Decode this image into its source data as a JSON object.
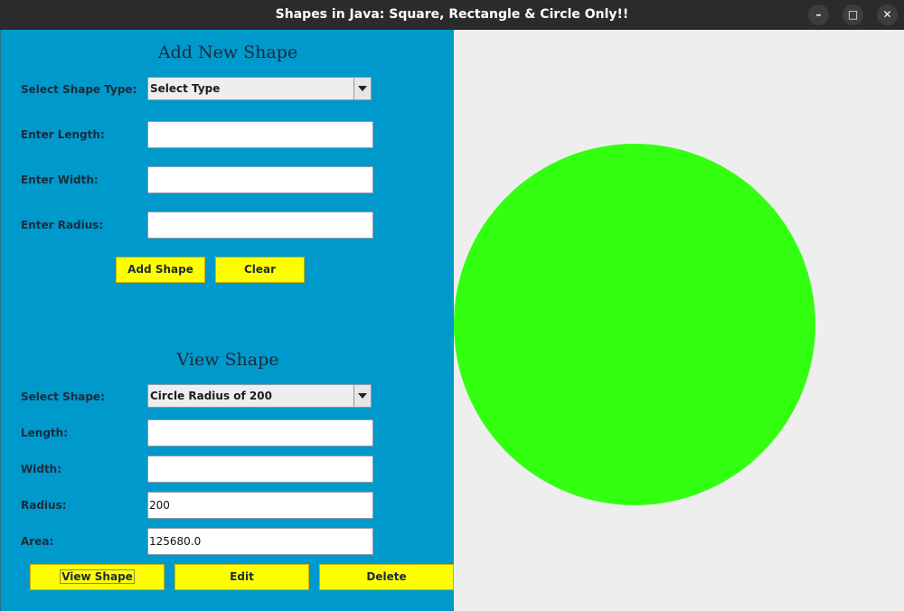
{
  "window": {
    "title": "Shapes in Java: Square, Rectangle & Circle Only!!",
    "controls": {
      "minimize": "–",
      "maximize": "□",
      "close": "✕"
    }
  },
  "add_panel": {
    "heading": "Add New Shape",
    "shape_type_label": "Select Shape Type:",
    "shape_type_selected": "Select Type",
    "length_label": "Enter Length:",
    "length_value": "",
    "width_label": "Enter Width:",
    "width_value": "",
    "radius_label": "Enter Radius:",
    "radius_value": "",
    "add_button": "Add Shape",
    "clear_button": "Clear"
  },
  "view_panel": {
    "heading": "View Shape",
    "shape_label": "Select Shape:",
    "shape_selected": "Circle Radius of 200",
    "length_label": "Length:",
    "length_value": "",
    "width_label": "Width:",
    "width_value": "",
    "radius_label": "Radius:",
    "radius_value": "200",
    "area_label": "Area:",
    "area_value": "125680.0",
    "view_button": "View Shape",
    "edit_button": "Edit",
    "delete_button": "Delete"
  },
  "canvas": {
    "shape": "circle",
    "fill_color": "#33ff11",
    "background": "#eeeeee"
  },
  "colors": {
    "panel_bg": "#0099cc",
    "button_bg": "#ffff00",
    "title_bar": "#2b2b2b"
  }
}
